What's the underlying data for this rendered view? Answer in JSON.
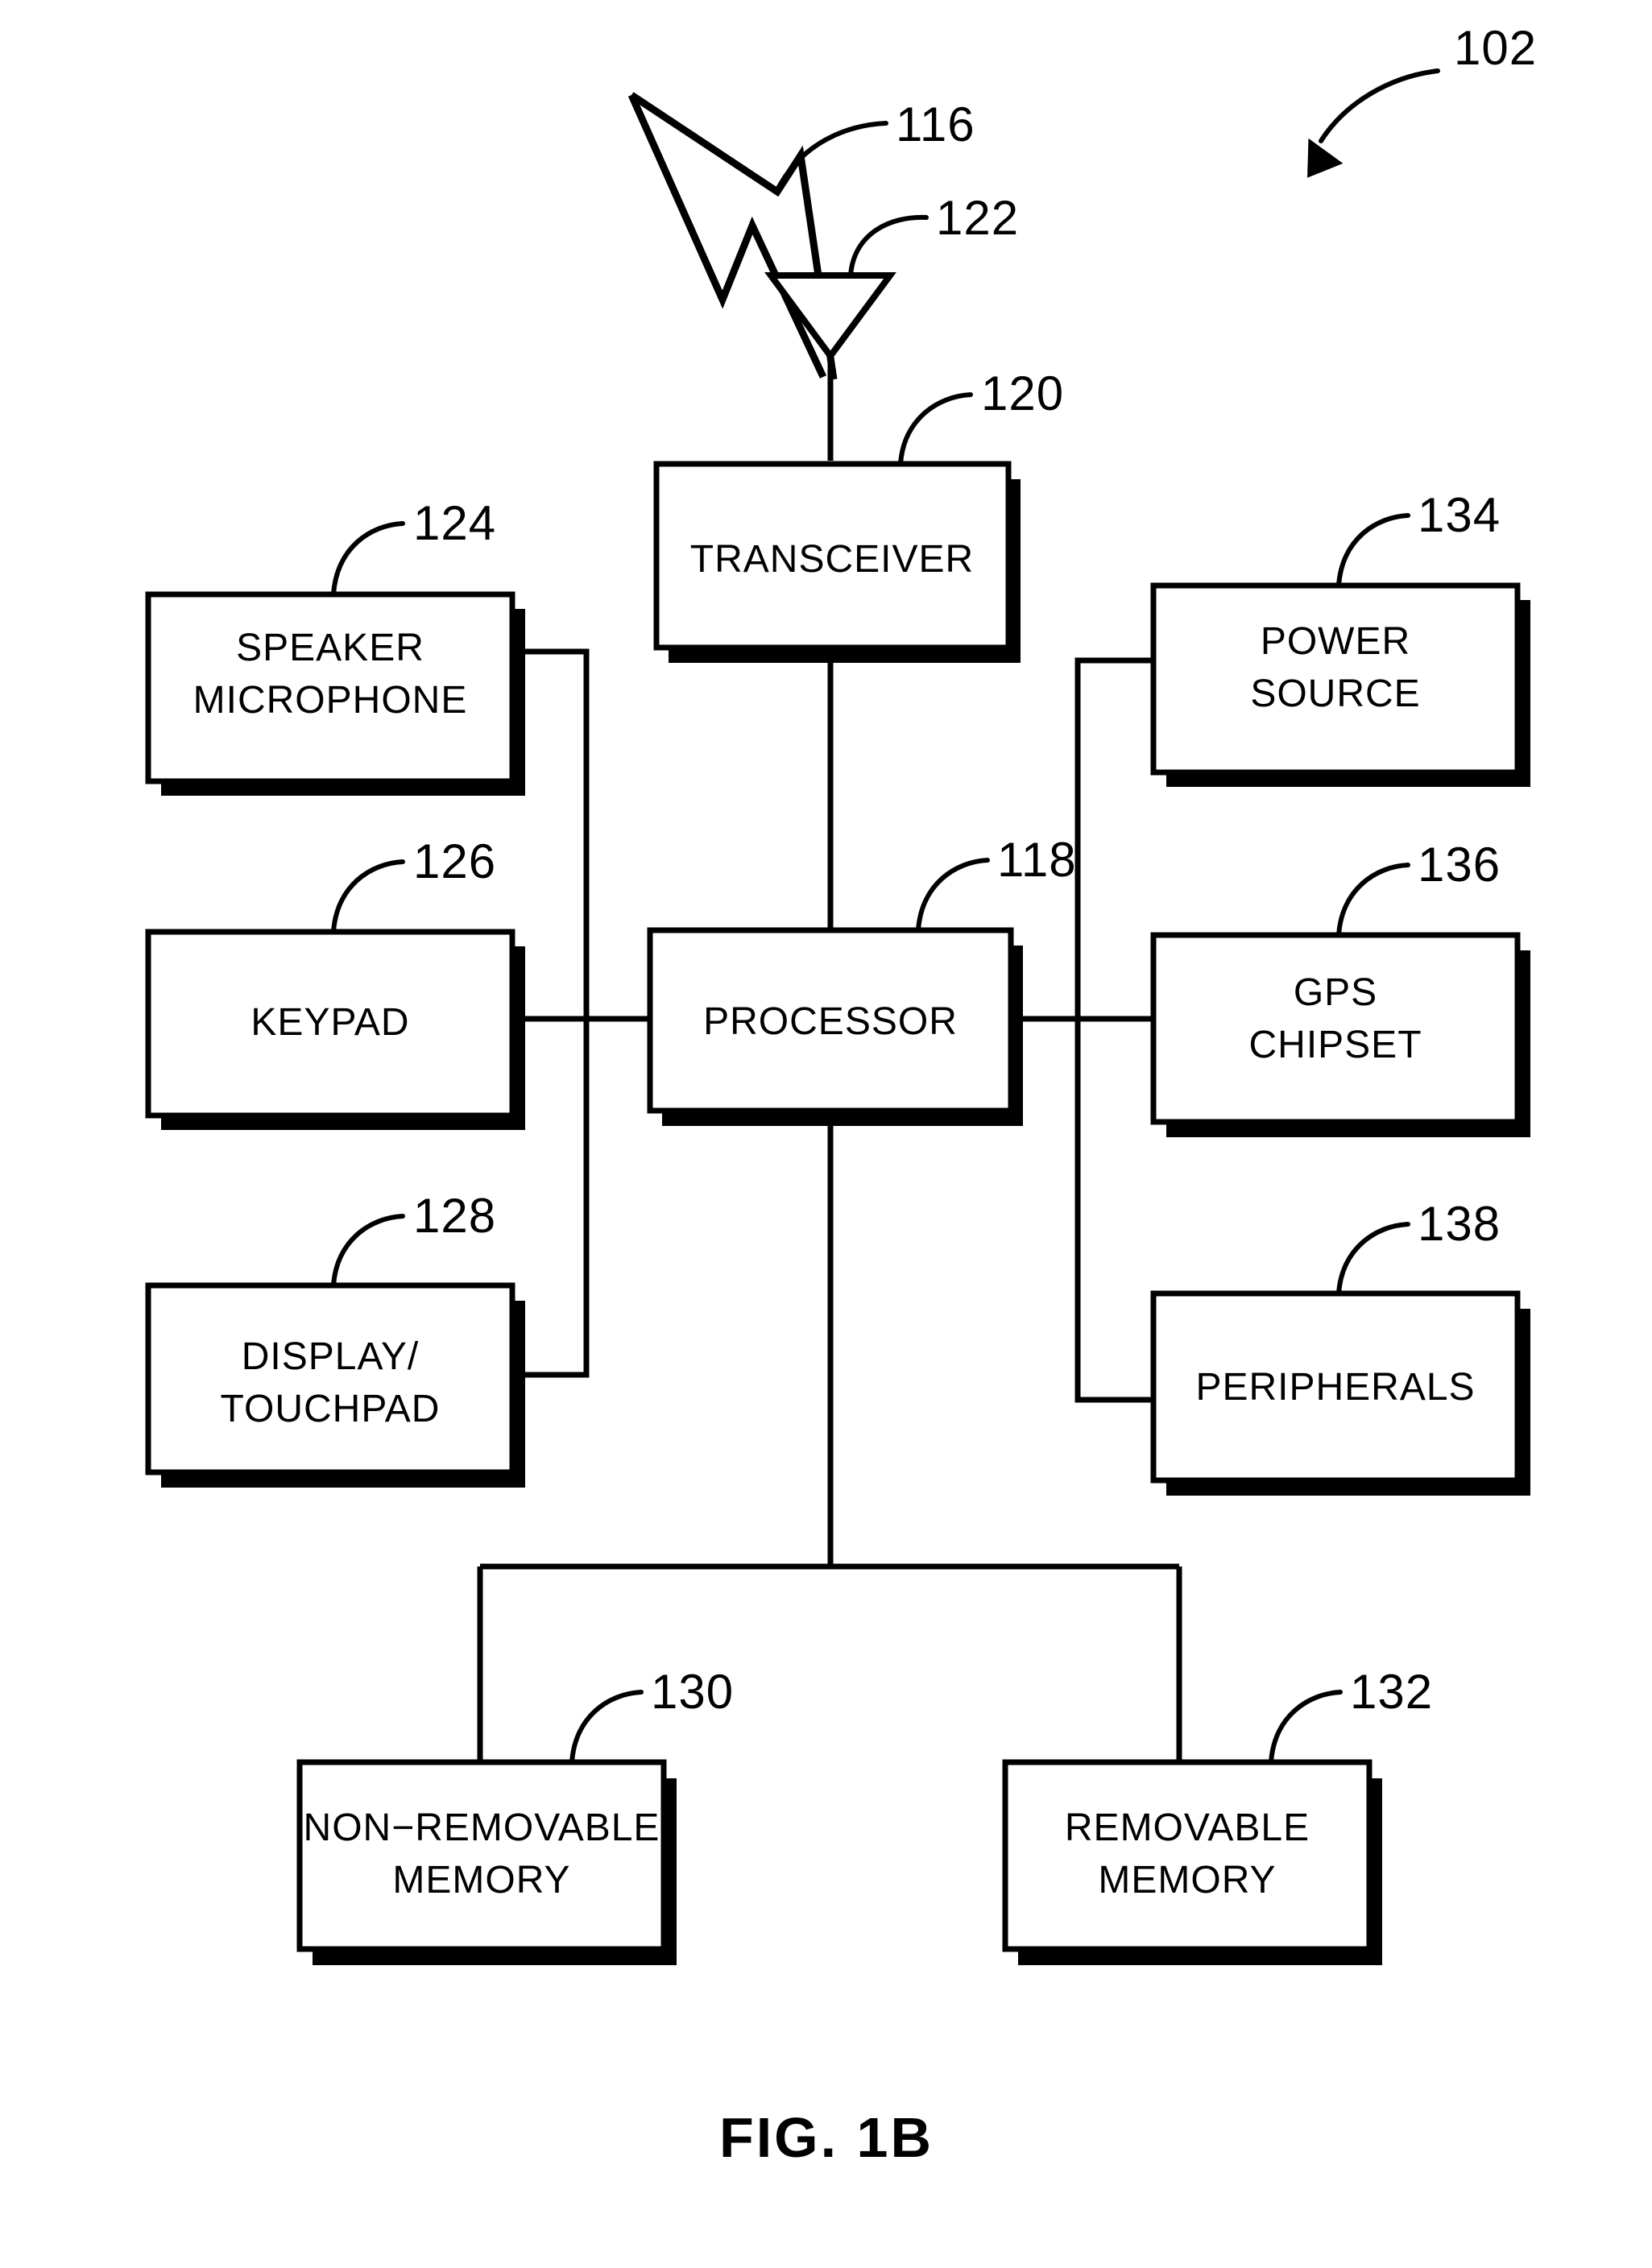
{
  "figure": {
    "caption": "FIG. 1B",
    "overall_ref": "102"
  },
  "references": {
    "bolt": "116",
    "antenna": "122",
    "transceiver": "120",
    "processor": "118",
    "speaker_microphone": "124",
    "keypad": "126",
    "display_touchpad": "128",
    "non_removable_memory": "130",
    "removable_memory": "132",
    "power_source": "134",
    "gps_chipset": "136",
    "peripherals": "138"
  },
  "blocks": {
    "transceiver": {
      "label": "TRANSCEIVER",
      "ref": "120"
    },
    "processor": {
      "label": "PROCESSOR",
      "ref": "118"
    },
    "speaker_microphone": {
      "line1": "SPEAKER",
      "line2": "MICROPHONE",
      "ref": "124"
    },
    "keypad": {
      "label": "KEYPAD",
      "ref": "126"
    },
    "display_touchpad": {
      "line1": "DISPLAY/",
      "line2": "TOUCHPAD",
      "ref": "128"
    },
    "non_removable_memory": {
      "line1": "NON−REMOVABLE",
      "line2": "MEMORY",
      "ref": "130"
    },
    "removable_memory": {
      "line1": "REMOVABLE",
      "line2": "MEMORY",
      "ref": "132"
    },
    "power_source": {
      "line1": "POWER",
      "line2": "SOURCE",
      "ref": "134"
    },
    "gps_chipset": {
      "line1": "GPS",
      "line2": "CHIPSET",
      "ref": "136"
    },
    "peripherals": {
      "label": "PERIPHERALS",
      "ref": "138"
    }
  },
  "icons": {
    "antenna": "antenna-triangle-icon",
    "rf_signal": "lightning-bolt-signal-icon",
    "callout_arrow": "curved-arrow-icon"
  },
  "colors": {
    "stroke": "#000000",
    "fill": "#ffffff",
    "background": "#ffffff"
  }
}
